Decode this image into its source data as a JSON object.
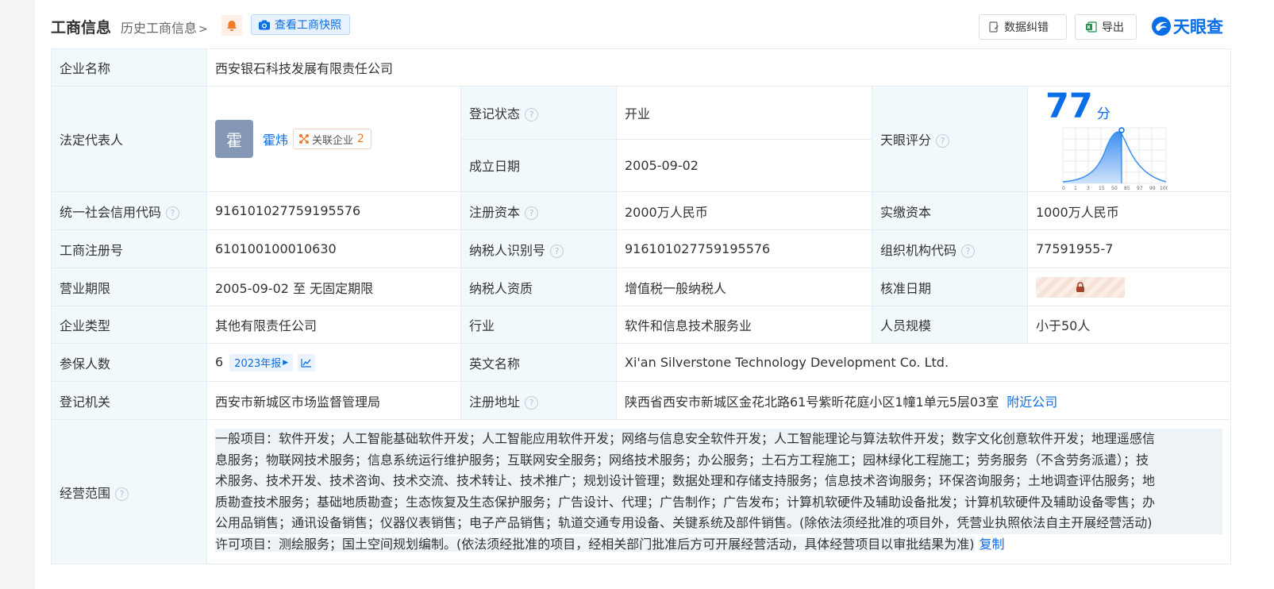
{
  "header": {
    "title": "工商信息",
    "history": "历史工商信息",
    "snapshot": "查看工商快照",
    "correct_btn": "数据纠错",
    "export_btn": "导出",
    "logo": "天眼查"
  },
  "rows": {
    "company_name": {
      "label": "企业名称",
      "value": "西安银石科技发展有限责任公司"
    },
    "legal_rep": {
      "label": "法定代表人",
      "avatar": "霍",
      "name": "霍炜",
      "related_label": "关联企业",
      "related_count": "2"
    },
    "reg_status": {
      "label": "登记状态",
      "value": "开业"
    },
    "est_date": {
      "label": "成立日期",
      "value": "2005-09-02"
    },
    "score": {
      "label": "天眼评分",
      "value": "77",
      "unit": "分",
      "axis": [
        "0",
        "1",
        "3",
        "15",
        "50",
        "85",
        "97",
        "99",
        "100"
      ],
      "marker_position": 0.5
    },
    "credit_code": {
      "label": "统一社会信用代码",
      "value": "916101027759195576"
    },
    "reg_capital": {
      "label": "注册资本",
      "value": "2000万人民币"
    },
    "paid_capital": {
      "label": "实缴资本",
      "value": "1000万人民币"
    },
    "reg_no": {
      "label": "工商注册号",
      "value": "610100100010630"
    },
    "tax_id": {
      "label": "纳税人识别号",
      "value": "916101027759195576"
    },
    "org_code": {
      "label": "组织机构代码",
      "value": "77591955-7"
    },
    "term": {
      "label": "营业期限",
      "value": "2005-09-02 至 无固定期限"
    },
    "tax_qual": {
      "label": "纳税人资质",
      "value": "增值税一般纳税人"
    },
    "approve_date": {
      "label": "核准日期"
    },
    "company_type": {
      "label": "企业类型",
      "value": "其他有限责任公司"
    },
    "industry": {
      "label": "行业",
      "value": "软件和信息技术服务业"
    },
    "staff_size": {
      "label": "人员规模",
      "value": "小于50人"
    },
    "insured": {
      "label": "参保人数",
      "value": "6",
      "year_tag": "2023年报"
    },
    "english_name": {
      "label": "英文名称",
      "value": "Xi'an Silverstone Technology Development Co. Ltd."
    },
    "authority": {
      "label": "登记机关",
      "value": "西安市新城区市场监督管理局"
    },
    "address": {
      "label": "注册地址",
      "value": "陕西省西安市新城区金花北路61号紫昕花庭小区1幢1单元5层03室",
      "nearby": "附近公司"
    },
    "scope": {
      "label": "经营范围",
      "lines": [
        "一般项目：软件开发；人工智能基础软件开发；人工智能应用软件开发；网络与信息安全软件开发；人工智能理论与算法软件开发；数字文化创意软件开发；地理遥感信",
        "息服务；物联网技术服务；信息系统运行维护服务；互联网安全服务；网络技术服务；办公服务；土石方工程施工；园林绿化工程施工；劳务服务（不含劳务派遣）；技",
        "术服务、技术开发、技术咨询、技术交流、技术转让、技术推广；规划设计管理；数据处理和存储支持服务；信息技术咨询服务；环保咨询服务；土地调查评估服务；地",
        "质勘查技术服务；基础地质勘查；生态恢复及生态保护服务；广告设计、代理；广告制作；广告发布；计算机软硬件及辅助设备批发；计算机软硬件及辅助设备零售；办",
        "公用品销售；通讯设备销售；仪器仪表销售；电子产品销售；轨道交通专用设备、关键系统及部件销售。(除依法须经批准的项目外，凭营业执照依法自主开展经营活动)",
        "许可项目：测绘服务；国土空间规划编制。(依法须经批准的项目，经相关部门批准后方可开展经营活动，具体经营项目以审批结果为准)"
      ],
      "copy": "复制"
    }
  }
}
